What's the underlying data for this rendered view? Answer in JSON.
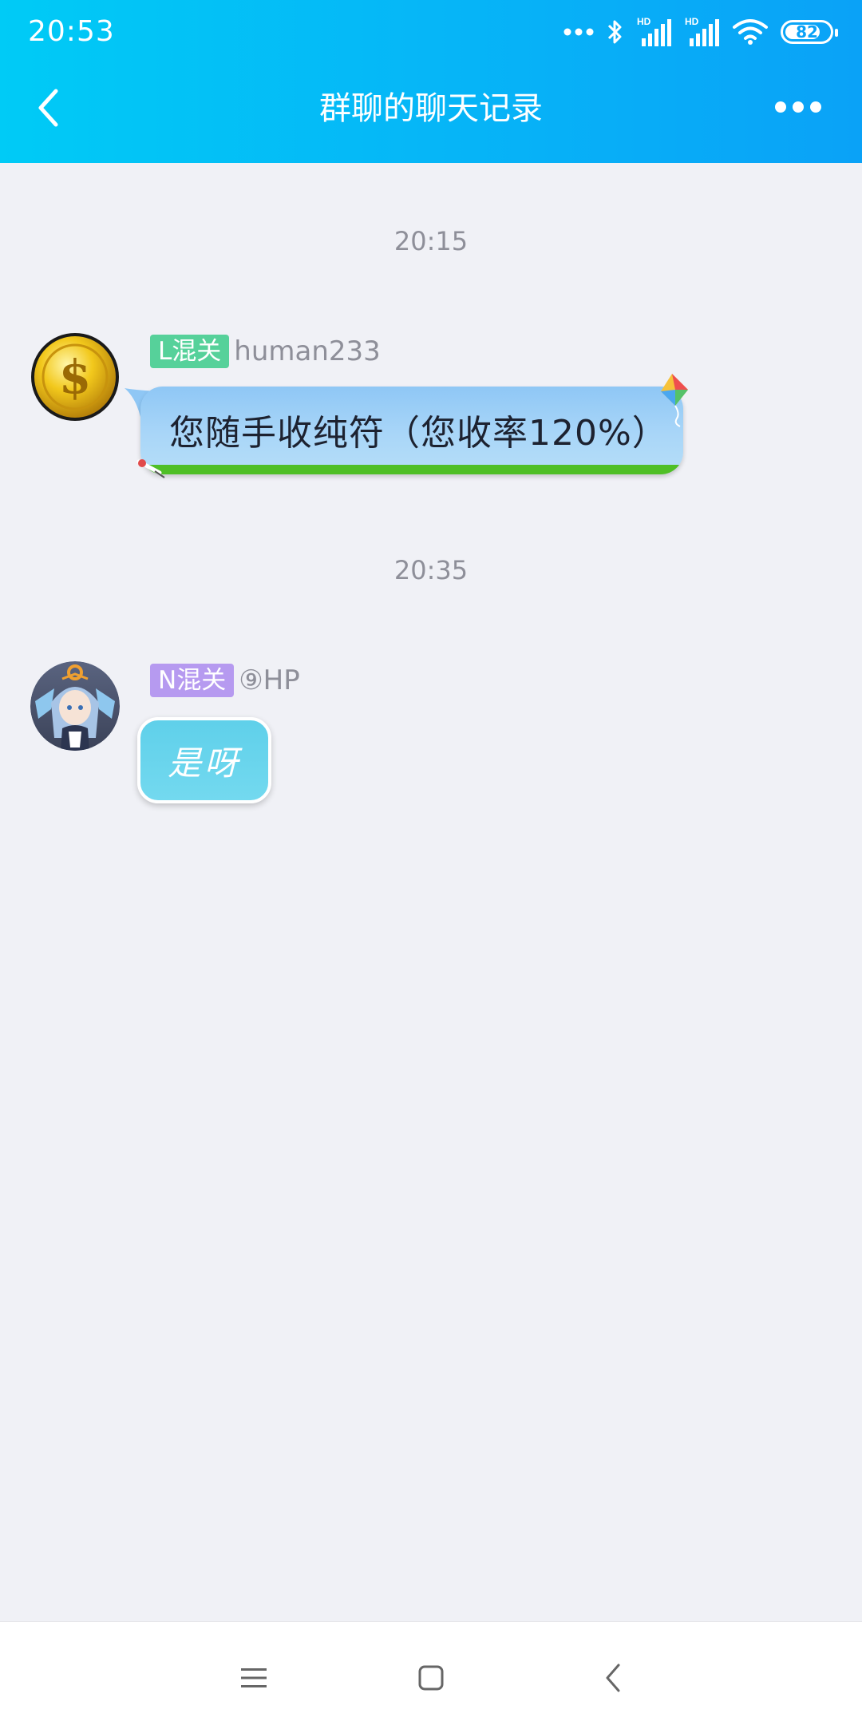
{
  "status_bar": {
    "time": "20:53",
    "battery": "82",
    "battery_level_percent": 82,
    "icons": [
      "more-dots-icon",
      "bluetooth-icon",
      "signal-hd-icon",
      "signal-hd-icon",
      "wifi-icon",
      "battery-icon"
    ]
  },
  "header": {
    "title": "群聊的聊天记录",
    "back_icon": "chevron-left-icon",
    "more_icon": "more-dots-icon",
    "gradient": [
      "#00cbf6",
      "#0aa2f7"
    ]
  },
  "messages": [
    {
      "timestamp": "20:15",
      "badge": "L混关",
      "badge_color": "#56d19a",
      "sender": "human233",
      "avatar": "gold-dollar-coin-avatar",
      "text": "您随手收纯符（您收率120%）"
    },
    {
      "timestamp": "20:35",
      "badge": "N混关",
      "badge_color": "#b69af0",
      "sender": "⑨HP",
      "avatar": "anime-character-avatar",
      "text": "是呀"
    }
  ],
  "nav_bar": {
    "icons": [
      "menu-icon",
      "home-square-icon",
      "back-icon"
    ]
  }
}
